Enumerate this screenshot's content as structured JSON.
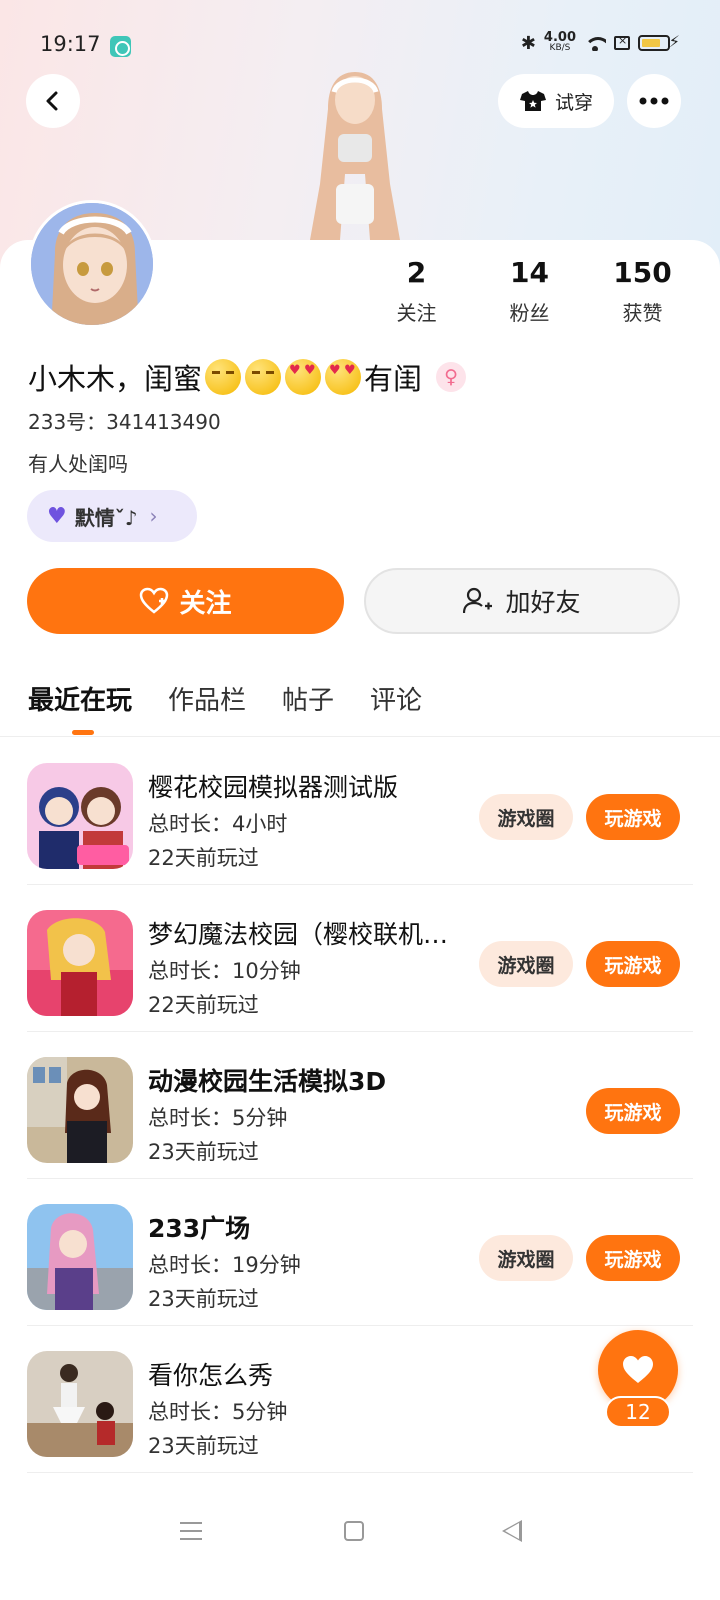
{
  "status_bar": {
    "time": "19:17",
    "net_speed_value": "4.00",
    "net_speed_unit": "KB/S"
  },
  "header": {
    "try_on_label": "试穿"
  },
  "profile": {
    "stats": [
      {
        "value": "2",
        "label": "关注"
      },
      {
        "value": "14",
        "label": "粉丝"
      },
      {
        "value": "150",
        "label": "获赞"
      }
    ],
    "nickname_part1": "小木木，闺蜜",
    "nickname_part2": "有闺",
    "uid": "233号：341413490",
    "bio": "有人处闺吗",
    "mood_label": "默情ˇ♪"
  },
  "actions": {
    "follow_label": "关注",
    "add_friend_label": "加好友"
  },
  "tabs": [
    {
      "label": "最近在玩"
    },
    {
      "label": "作品栏"
    },
    {
      "label": "帖子"
    },
    {
      "label": "评论"
    }
  ],
  "games": [
    {
      "name": "樱花校园模拟器测试版",
      "duration": "总时长：4小时",
      "last_played": "22天前玩过",
      "circle_label": "游戏圈",
      "play_label": "玩游戏"
    },
    {
      "name": "梦幻魔法校园（樱校联机版）",
      "duration": "总时长：10分钟",
      "last_played": "22天前玩过",
      "circle_label": "游戏圈",
      "play_label": "玩游戏"
    },
    {
      "name": "动漫校园生活模拟3D",
      "duration": "总时长：5分钟",
      "last_played": "23天前玩过",
      "play_label": "玩游戏"
    },
    {
      "name": "233广场",
      "duration": "总时长：19分钟",
      "last_played": "23天前玩过",
      "circle_label": "游戏圈",
      "play_label": "玩游戏"
    },
    {
      "name": "看你怎么秀",
      "duration": "总时长：5分钟",
      "last_played": "23天前玩过"
    }
  ],
  "like_fab": {
    "count": "12"
  },
  "colors": {
    "accent": "#ff7410",
    "circle_btn_bg": "#fde9dd",
    "mood_pill_bg": "#ece9fb"
  },
  "icons": [
    "back-arrow-icon",
    "shirt-icon",
    "more-icon",
    "female-icon",
    "heart-icon",
    "add-user-icon"
  ]
}
